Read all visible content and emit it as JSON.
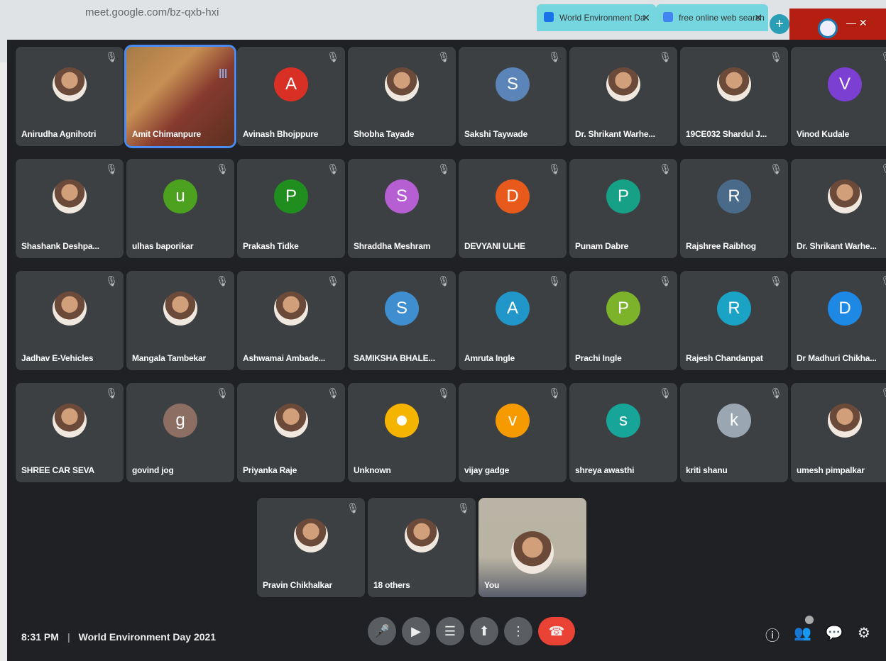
{
  "browser": {
    "url": "meet.google.com/bz-qxb-hxi",
    "tabs": [
      {
        "label": "World Environment Da",
        "fav_color": "#1a73e8"
      },
      {
        "label": "free online web search",
        "fav_color": "#4285f4"
      }
    ],
    "new_tab_symbol": "+",
    "window_controls": "— ✕"
  },
  "participants": [
    {
      "name": "Anirudha Agnihotri",
      "avatar": "photo"
    },
    {
      "name": "Amit Chimanpure",
      "avatar": "camera-active"
    },
    {
      "name": "Avinash Bhojppure",
      "avatar": "letter",
      "letter": "A",
      "color": "#d93025"
    },
    {
      "name": "Shobha Tayade",
      "avatar": "photo"
    },
    {
      "name": "Sakshi Taywade",
      "avatar": "letter",
      "letter": "S",
      "color": "#5b85b8"
    },
    {
      "name": "Dr. Shrikant Warhe...",
      "avatar": "photo"
    },
    {
      "name": "19CE032 Shardul J...",
      "avatar": "photo"
    },
    {
      "name": "Vinod Kudale",
      "avatar": "letter",
      "letter": "V",
      "color": "#7b3fd1"
    },
    {
      "name": "Shashank Deshpa...",
      "avatar": "photo"
    },
    {
      "name": "ulhas baporikar",
      "avatar": "letter",
      "letter": "u",
      "color": "#4ca11f"
    },
    {
      "name": "Prakash Tidke",
      "avatar": "letter",
      "letter": "P",
      "color": "#1f8e1f"
    },
    {
      "name": "Shraddha Meshram",
      "avatar": "letter",
      "letter": "S",
      "color": "#b65fd3"
    },
    {
      "name": "DEVYANI ULHE",
      "avatar": "letter",
      "letter": "D",
      "color": "#e85a1c"
    },
    {
      "name": "Punam Dabre",
      "avatar": "letter",
      "letter": "P",
      "color": "#16a085"
    },
    {
      "name": "Rajshree Raibhog",
      "avatar": "letter",
      "letter": "R",
      "color": "#4a6a8a"
    },
    {
      "name": "Dr. Shrikant Warhe...",
      "avatar": "photo"
    },
    {
      "name": "Jadhav E-Vehicles",
      "avatar": "photo"
    },
    {
      "name": "Mangala Tambekar",
      "avatar": "photo"
    },
    {
      "name": "Ashwamai Ambade...",
      "avatar": "photo"
    },
    {
      "name": "SAMIKSHA BHALE...",
      "avatar": "letter",
      "letter": "S",
      "color": "#3f8fd0"
    },
    {
      "name": "Amruta Ingle",
      "avatar": "letter",
      "letter": "A",
      "color": "#2196c8"
    },
    {
      "name": "Prachi Ingle",
      "avatar": "letter",
      "letter": "P",
      "color": "#7cb32a"
    },
    {
      "name": "Rajesh Chandanpat",
      "avatar": "letter",
      "letter": "R",
      "color": "#1ba3c6"
    },
    {
      "name": "Dr Madhuri Chikha...",
      "avatar": "letter",
      "letter": "D",
      "color": "#1e88e5"
    },
    {
      "name": "SHREE CAR SEVA",
      "avatar": "photo"
    },
    {
      "name": "govind jog",
      "avatar": "letter",
      "letter": "g",
      "color": "#8d6e63"
    },
    {
      "name": "Priyanka Raje",
      "avatar": "photo"
    },
    {
      "name": "Unknown",
      "avatar": "letter",
      "letter": "",
      "color": "#f5b400"
    },
    {
      "name": "vijay gadge",
      "avatar": "letter",
      "letter": "v",
      "color": "#f59a00"
    },
    {
      "name": "shreya awasthi",
      "avatar": "letter",
      "letter": "s",
      "color": "#17a59a"
    },
    {
      "name": "kriti shanu",
      "avatar": "letter",
      "letter": "k",
      "color": "#9aa7b3"
    },
    {
      "name": "umesh pimpalkar",
      "avatar": "photo"
    },
    {
      "name": "Pravin Chikhalkar",
      "avatar": "photo"
    },
    {
      "name": "18 others",
      "avatar": "group"
    },
    {
      "name": "You",
      "avatar": "camera-self"
    }
  ],
  "meeting": {
    "time": "8:31 PM",
    "title": "World Environment Day 2021"
  },
  "controls": {
    "mic": "🎤",
    "camera": "▶",
    "captions": "☰",
    "present": "⬆",
    "more": "⋮",
    "end": "☎",
    "info": "ⓘ",
    "people": "👥",
    "chat": "💬",
    "activities": "⚙"
  }
}
